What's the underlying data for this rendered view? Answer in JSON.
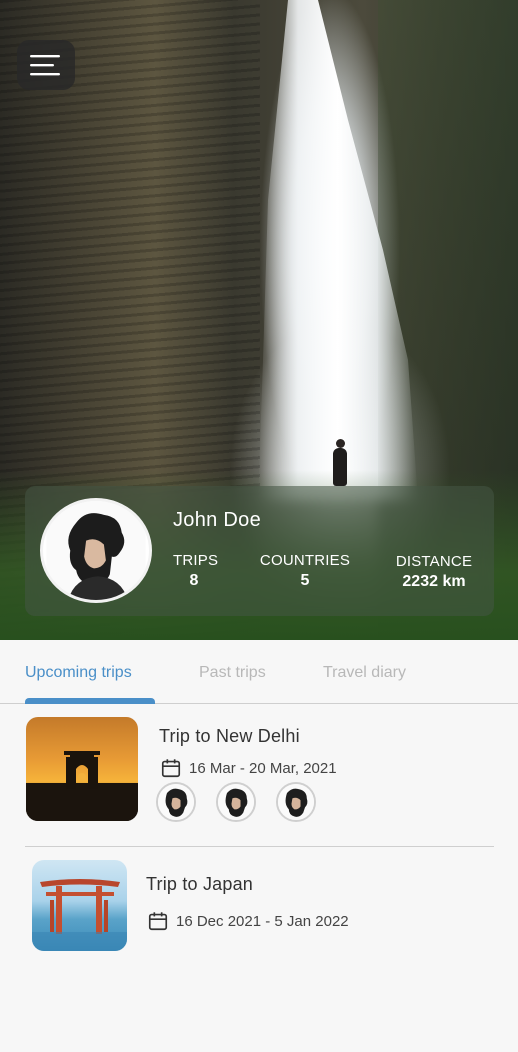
{
  "profile": {
    "name": "John Doe",
    "stats": [
      {
        "label": "TRIPS",
        "value": "8"
      },
      {
        "label": "COUNTRIES",
        "value": "5"
      },
      {
        "label": "DISTANCE",
        "value": "2232 km"
      }
    ]
  },
  "tabs": [
    {
      "label": "Upcoming trips",
      "active": true
    },
    {
      "label": "Past trips",
      "active": false
    },
    {
      "label": "Travel diary",
      "active": false
    }
  ],
  "trips": [
    {
      "title": "Trip to New Delhi",
      "dates": "16 Mar - 20 Mar, 2021",
      "companions": 3
    },
    {
      "title": "Trip to Japan",
      "dates": "16 Dec 2021 - 5 Jan 2022",
      "companions": 0
    }
  ],
  "colors": {
    "accent": "#4a8fc8",
    "inactive_tab": "#b8b8b8",
    "text": "#333333"
  },
  "icons": {
    "menu": "menu-icon",
    "calendar": "calendar-icon"
  }
}
